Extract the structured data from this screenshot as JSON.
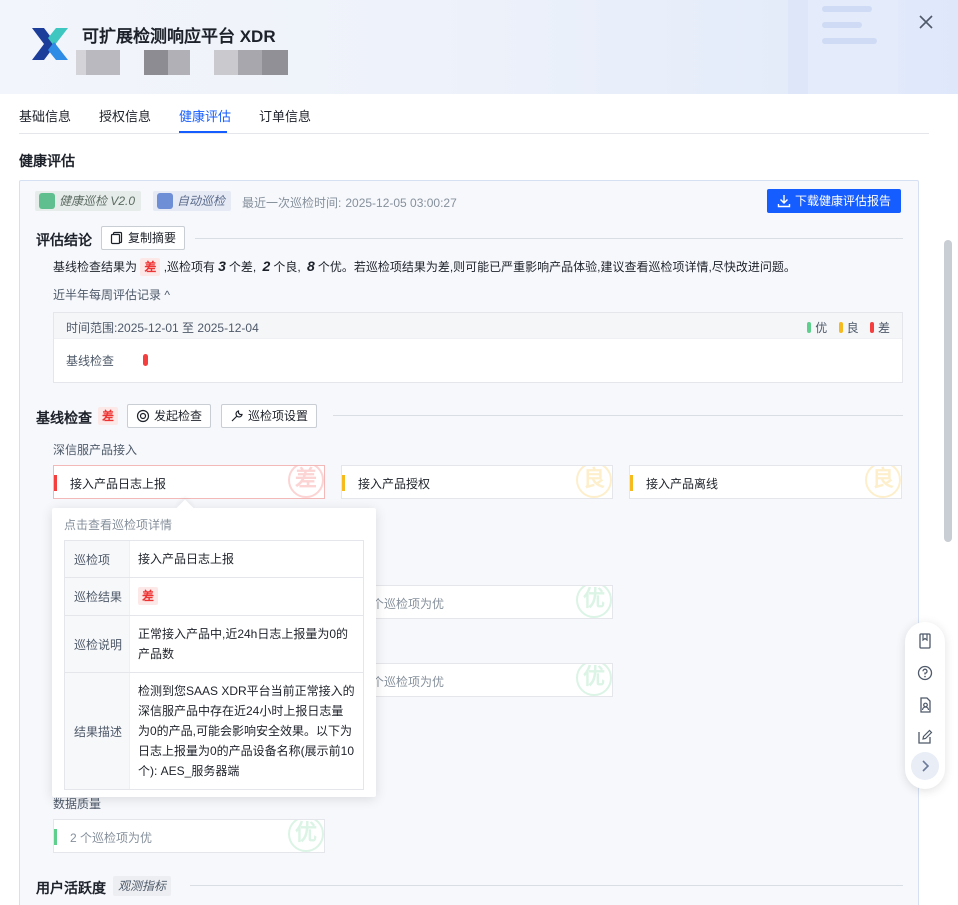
{
  "header": {
    "app_title": "可扩展检测响应平台 XDR"
  },
  "tabs": [
    {
      "label": "基础信息",
      "active": false
    },
    {
      "label": "授权信息",
      "active": false
    },
    {
      "label": "健康评估",
      "active": true
    },
    {
      "label": "订单信息",
      "active": false
    }
  ],
  "section_title": "健康评估",
  "toolbar": {
    "badge_patrol": "健康巡检 V2.0",
    "badge_auto": "自动巡检",
    "last_patrol_label": "最近一次巡检时间:",
    "last_patrol_value": "2025-12-05 03:00:27",
    "download_label": "下载健康评估报告"
  },
  "conclusion": {
    "title": "评估结论",
    "copy_button": "复制摘要",
    "summary_pre": "基线检查结果为",
    "summary_result": "差",
    "summary_mid1": ",巡检项有",
    "bad_count": "3",
    "summary_mid2": "个差,",
    "good_count": "2",
    "summary_mid3": "个良,",
    "excellent_count": "8",
    "summary_post": "个优。若巡检项结果为差,则可能已严重影响产品体验,建议查看巡检项详情,尽快改进问题。",
    "history_link": "近半年每周评估记录 ^"
  },
  "weekly": {
    "range_label": "时间范围:",
    "range_value": "2025-12-01 至 2025-12-04",
    "legend": [
      {
        "label": "优",
        "color": "#5fcf8e"
      },
      {
        "label": "良",
        "color": "#f7ba1e"
      },
      {
        "label": "差",
        "color": "#f53f3f"
      }
    ],
    "row_label": "基线检查"
  },
  "baseline": {
    "title": "基线检查",
    "result": "差",
    "start_button": "发起检查",
    "settings_button": "巡检项设置",
    "group1": "深信服产品接入",
    "cards_row1": [
      {
        "label": "接入产品日志上报",
        "level": "差",
        "color": "#f53f3f"
      },
      {
        "label": "接入产品授权",
        "level": "良",
        "color": "#f7ba1e"
      },
      {
        "label": "接入产品离线",
        "level": "良",
        "color": "#f7ba1e"
      }
    ],
    "card_mid1": {
      "label": "个巡检项为优",
      "level": "优"
    },
    "card_mid2": {
      "label": "个巡检项为优",
      "level": "优"
    },
    "group_data": "数据质量",
    "card_data": {
      "label": "2 个巡检项为优",
      "level": "优"
    }
  },
  "popover": {
    "title": "点击查看巡检项详情",
    "rows": [
      {
        "key": "巡检项",
        "value": "接入产品日志上报"
      },
      {
        "key": "巡检结果",
        "value": "差"
      },
      {
        "key": "巡检说明",
        "value": "正常接入产品中,近24h日志上报量为0的产品数"
      },
      {
        "key": "结果描述",
        "value": "检测到您SAAS XDR平台当前正常接入的深信服产品中存在近24小时上报日志量为0的产品,可能会影响安全效果。以下为日志上报量为0的产品设备名称(展示前10个): AES_服务器端"
      }
    ]
  },
  "activity": {
    "title": "用户活跃度",
    "tag": "观测指标"
  },
  "colors": {
    "primary": "#165dff",
    "bad": "#f53f3f",
    "good": "#f7ba1e",
    "excellent": "#5fcf8e"
  }
}
